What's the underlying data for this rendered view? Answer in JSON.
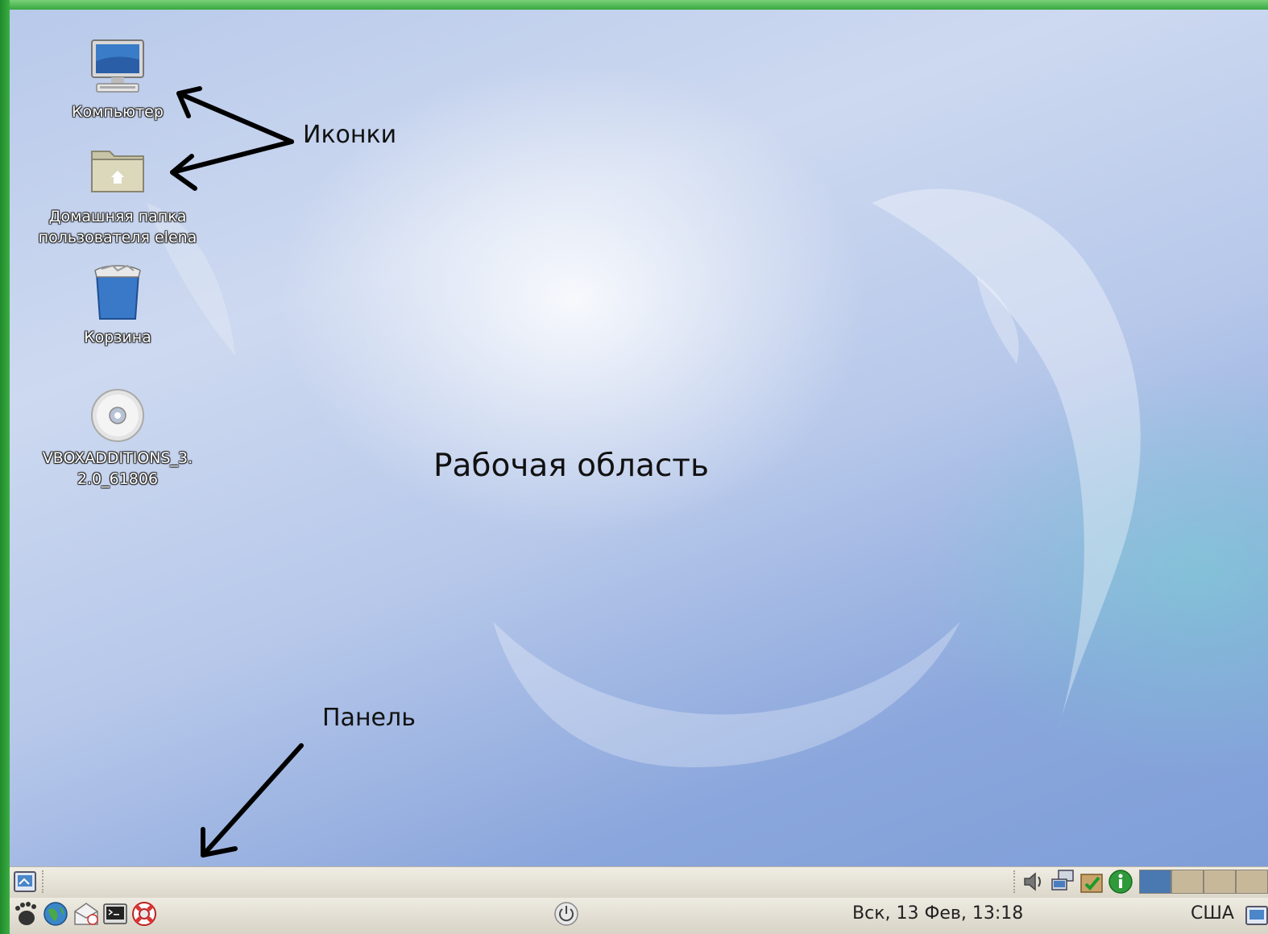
{
  "desktop": {
    "icons": [
      {
        "label": "Компьютер"
      },
      {
        "label_line1": "Домашняя папка",
        "label_line2": "пользователя elena"
      },
      {
        "label": "Корзина"
      },
      {
        "label_line1": "VBOXADDITIONS_3.",
        "label_line2": "2.0_61806"
      }
    ]
  },
  "annotations": {
    "icons": "Иконки",
    "workspace": "Рабочая область",
    "panel": "Панель"
  },
  "panel": {
    "clock": "Вск, 13 Фев, 13:18",
    "keyboard_layout": "США"
  },
  "colors": {
    "frame": "#2f9a3a",
    "panel": "#e6e2d8",
    "workspace_active": "#4a78b0",
    "workspace_inactive": "#c8b89a"
  }
}
